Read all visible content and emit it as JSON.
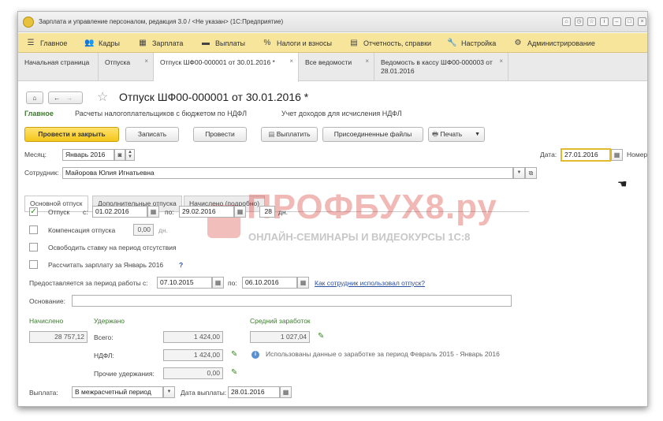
{
  "titlebar": {
    "title": "Зарплата и управление персоналом, редакция 3.0 / <Не указан> (1С:Предприятие)"
  },
  "menu": [
    "Главное",
    "Кадры",
    "Зарплата",
    "Выплаты",
    "Налоги и взносы",
    "Отчетность, справки",
    "Настройка",
    "Администрирование"
  ],
  "tabs": [
    {
      "label": "Начальная страница"
    },
    {
      "label": "Отпуска"
    },
    {
      "label": "Отпуск ШФ00-000001 от 30.01.2016 *"
    },
    {
      "label": "Все ведомости"
    },
    {
      "label": "Ведомость в кассу ШФ00-000003 от 28.01.2016"
    }
  ],
  "doc": {
    "title": "Отпуск ШФ00-000001 от 30.01.2016 *",
    "sections": [
      "Главное",
      "Расчеты налогоплательщиков с бюджетом по НДФЛ",
      "Учет доходов для исчисления НДФЛ"
    ]
  },
  "toolbar": {
    "post_close": "Провести и закрыть",
    "save": "Записать",
    "post": "Провести",
    "pay": "Выплатить",
    "attached": "Присоединенные файлы",
    "print": "Печать"
  },
  "form": {
    "month_label": "Месяц:",
    "month_value": "Январь 2016",
    "date_label": "Дата:",
    "date_value": "27.01.2016",
    "number_label": "Номер",
    "employee_label": "Сотрудник:",
    "employee_value": "Майорова Юлия Игнатьевна"
  },
  "subtabs": [
    "Основной отпуск",
    "Дополнительные отпуска",
    "Начислено (подробно)"
  ],
  "vacation": {
    "label": "Отпуск",
    "from_label": "с:",
    "from": "01.02.2016",
    "to_label": "по:",
    "to": "29.02.2016",
    "days": "28",
    "days_unit": "дн.",
    "checked": true
  },
  "options": {
    "compensation": "Компенсация отпуска",
    "compensation_days": "0,00",
    "compensation_unit": "дн.",
    "free_rate": "Освободить ставку на период отсутствия",
    "calc_salary": "Рассчитать зарплату за Январь 2016",
    "help": "?"
  },
  "period": {
    "label": "Предоставляется за период работы с:",
    "from": "07.10.2015",
    "to_label": "по:",
    "to": "06.10.2016",
    "link": "Как сотрудник использовал отпуск?"
  },
  "basis_label": "Основание:",
  "totals": {
    "accrued_label": "Начислено",
    "accrued": "28 757,12",
    "withheld_label": "Удержано",
    "total_label": "Всего:",
    "total": "1 424,00",
    "ndfl_label": "НДФЛ:",
    "ndfl": "1 424,00",
    "other_label": "Прочие удержания:",
    "other": "0,00",
    "avg_label": "Средний заработок",
    "avg": "1 027,04",
    "info": "Использованы данные о заработке за период Февраль 2015 - Январь 2016"
  },
  "payment": {
    "label": "Выплата:",
    "value": "В межрасчетный период",
    "date_label": "Дата выплаты:",
    "date": "28.01.2016"
  },
  "watermark": {
    "line1": "ПРОФБУХ8.ру",
    "line2": "ОНЛАЙН-СЕМИНАРЫ И ВИДЕОКУРСЫ 1С:8"
  }
}
